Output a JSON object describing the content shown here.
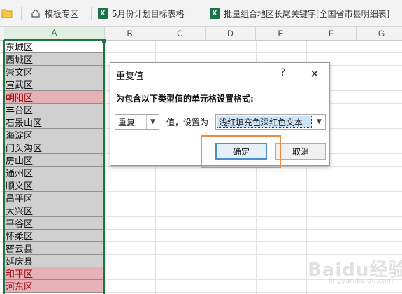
{
  "tabs": [
    {
      "label": "模板专区",
      "icon": "home-icon"
    },
    {
      "label": "5月份计划目标表格",
      "icon": "excel-icon"
    },
    {
      "label": "批量组合地区长尾关键字[全国省市县明细表]",
      "icon": "excel-icon"
    }
  ],
  "excel_icon_glyph": "X",
  "columns": [
    "A",
    "B",
    "C",
    "D",
    "E",
    "F",
    "G"
  ],
  "cells": [
    {
      "text": "东城区",
      "style": "white"
    },
    {
      "text": "西城区",
      "style": "gray"
    },
    {
      "text": "崇文区",
      "style": "gray"
    },
    {
      "text": "宣武区",
      "style": "gray"
    },
    {
      "text": "朝阳区",
      "style": "red"
    },
    {
      "text": "丰台区",
      "style": "gray"
    },
    {
      "text": "石景山区",
      "style": "gray"
    },
    {
      "text": "海淀区",
      "style": "gray"
    },
    {
      "text": "门头沟区",
      "style": "gray"
    },
    {
      "text": "房山区",
      "style": "gray"
    },
    {
      "text": "通州区",
      "style": "gray"
    },
    {
      "text": "顺义区",
      "style": "gray"
    },
    {
      "text": "昌平区",
      "style": "gray"
    },
    {
      "text": "大兴区",
      "style": "gray"
    },
    {
      "text": "平谷区",
      "style": "gray"
    },
    {
      "text": "怀柔区",
      "style": "gray"
    },
    {
      "text": "密云县",
      "style": "gray"
    },
    {
      "text": "延庆县",
      "style": "gray"
    },
    {
      "text": "和平区",
      "style": "red"
    },
    {
      "text": "河东区",
      "style": "red"
    }
  ],
  "dialog": {
    "title": "重复值",
    "help": "?",
    "close": "✕",
    "prompt": "为包含以下类型值的单元格设置格式:",
    "type_value": "重复",
    "mid_text": "值，设置为",
    "format_value": "浅红填充色深红色文本",
    "ok_label": "确定",
    "cancel_label": "取消"
  },
  "colors": {
    "accent_green": "#217346",
    "duplicate_fill": "#e6b2b8",
    "duplicate_text": "#9c0006",
    "highlight_orange": "#f0883e"
  },
  "watermark": {
    "main": "Baidu经验",
    "sub": "jingyan.baidu.com"
  }
}
